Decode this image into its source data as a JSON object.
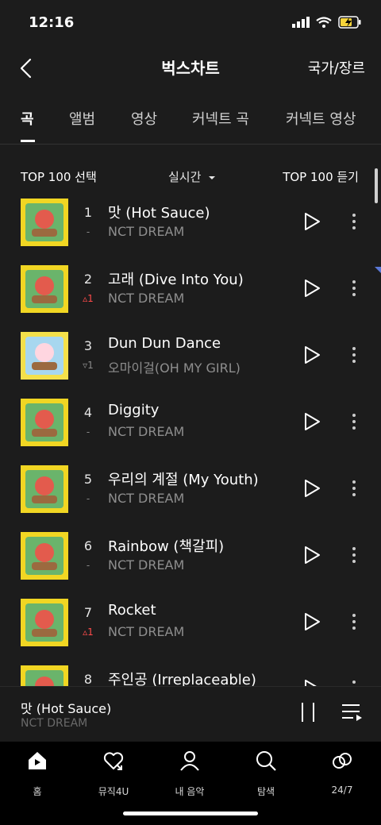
{
  "status": {
    "time": "12:16"
  },
  "header": {
    "title": "벅스차트",
    "right_label": "국가/장르"
  },
  "tabs": [
    {
      "label": "곡"
    },
    {
      "label": "앨범"
    },
    {
      "label": "영상"
    },
    {
      "label": "커넥트 곡"
    },
    {
      "label": "커넥트 영상"
    }
  ],
  "subbar": {
    "left": "TOP 100 선택",
    "mid": "실시간",
    "right": "TOP 100 듣기"
  },
  "songs": [
    {
      "rank": "1",
      "change": "-",
      "change_dir": "none",
      "title": "맛 (Hot Sauce)",
      "artist": "NCT DREAM"
    },
    {
      "rank": "2",
      "change": "▵1",
      "change_dir": "up",
      "title": "고래 (Dive Into You)",
      "artist": "NCT DREAM"
    },
    {
      "rank": "3",
      "change": "▿1",
      "change_dir": "down",
      "title": "Dun Dun Dance",
      "artist": "오마이걸(OH MY GIRL)"
    },
    {
      "rank": "4",
      "change": "-",
      "change_dir": "none",
      "title": "Diggity",
      "artist": "NCT DREAM"
    },
    {
      "rank": "5",
      "change": "-",
      "change_dir": "none",
      "title": "우리의 계절 (My Youth)",
      "artist": "NCT DREAM"
    },
    {
      "rank": "6",
      "change": "-",
      "change_dir": "none",
      "title": "Rainbow (책갈피)",
      "artist": "NCT DREAM"
    },
    {
      "rank": "7",
      "change": "▵1",
      "change_dir": "up",
      "title": "Rocket",
      "artist": "NCT DREAM"
    },
    {
      "rank": "8",
      "change": "",
      "change_dir": "none",
      "title": "주인공 (Irreplaceable)",
      "artist": ""
    }
  ],
  "mini_player": {
    "title": "맛 (Hot Sauce)",
    "artist": "NCT DREAM"
  },
  "tabbar": [
    {
      "label": "홈",
      "icon": "home-icon"
    },
    {
      "label": "뮤직4U",
      "icon": "heart-icon"
    },
    {
      "label": "내 음악",
      "icon": "person-icon"
    },
    {
      "label": "탐색",
      "icon": "search-icon"
    },
    {
      "label": "24/7",
      "icon": "infinity-icon"
    }
  ],
  "colors": {
    "background": "#1c1c1c",
    "rank_up": "#ff4b4b",
    "album_yellow": "#f1d623"
  }
}
